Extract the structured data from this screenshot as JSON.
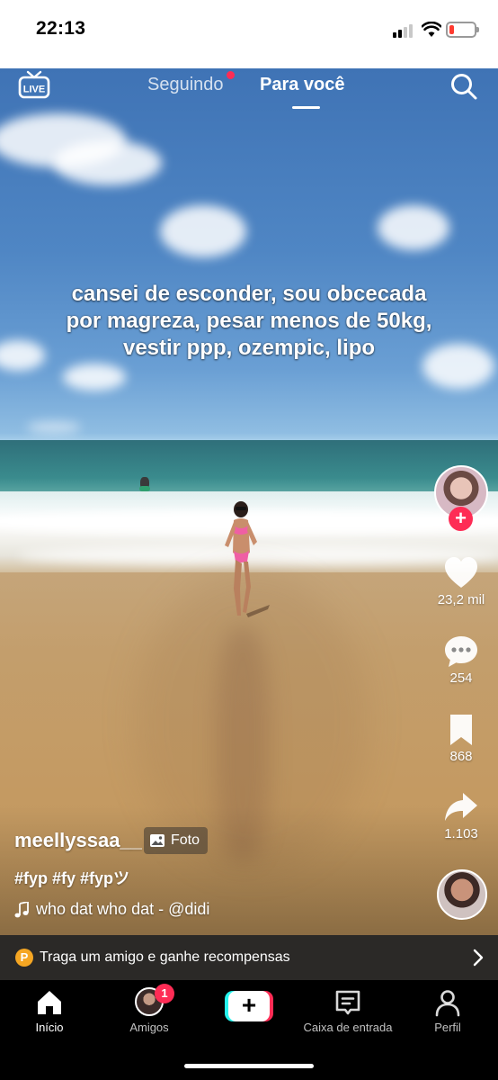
{
  "status_bar": {
    "time": "22:13"
  },
  "top_nav": {
    "live_label": "LIVE",
    "following_label": "Seguindo",
    "for_you_label": "Para você"
  },
  "post": {
    "caption_overlay": "cansei de esconder, sou obcecada por magreza, pesar menos de 50kg, vestir ppp, ozempic, lipo",
    "username": "meellyssaa__",
    "photo_badge": "Foto",
    "hashtags": "#fyp #fy #fypツ",
    "sound": "who dat who dat - @didi"
  },
  "actions": {
    "likes": "23,2 mil",
    "comments": "254",
    "bookmarks": "868",
    "shares": "1.103"
  },
  "promo": {
    "coin_letter": "P",
    "text": "Traga um amigo e ganhe recompensas"
  },
  "tab_bar": {
    "home": "Início",
    "friends": "Amigos",
    "friends_badge": "1",
    "inbox": "Caixa de entrada",
    "profile": "Perfil"
  },
  "colors": {
    "accent": "#fe2c55",
    "cyan": "#25f4ee",
    "coin": "#f5a623"
  }
}
